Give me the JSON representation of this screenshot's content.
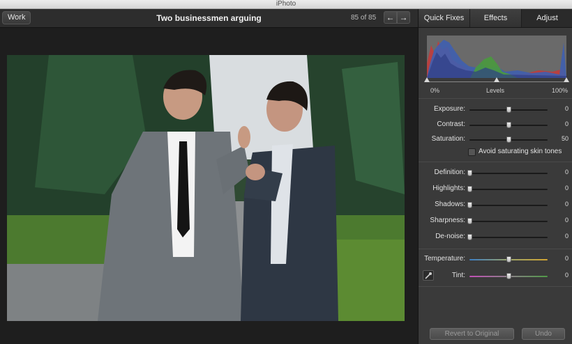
{
  "window": {
    "title": "iPhoto"
  },
  "toolbar": {
    "back_label": "Work",
    "photo_title": "Two businessmen arguing",
    "counter": "85 of 85",
    "prev_icon": "←",
    "next_icon": "→"
  },
  "panel": {
    "tabs": [
      {
        "label": "Quick Fixes",
        "active": false
      },
      {
        "label": "Effects",
        "active": false
      },
      {
        "label": "Adjust",
        "active": true
      }
    ],
    "levels": {
      "label": "Levels",
      "min_label": "0%",
      "max_label": "100%"
    },
    "group1": [
      {
        "label": "Exposure:",
        "value": "0",
        "level": 0.5
      },
      {
        "label": "Contrast:",
        "value": "0",
        "level": 0.5
      },
      {
        "label": "Saturation:",
        "value": "50",
        "level": 0.5
      }
    ],
    "skin_tones": {
      "label": "Avoid saturating skin tones",
      "checked": false
    },
    "group2": [
      {
        "label": "Definition:",
        "value": "0",
        "level": 0
      },
      {
        "label": "Highlights:",
        "value": "0",
        "level": 0
      },
      {
        "label": "Shadows:",
        "value": "0",
        "level": 0
      },
      {
        "label": "Sharpness:",
        "value": "0",
        "level": 0
      },
      {
        "label": "De-noise:",
        "value": "0",
        "level": 0
      }
    ],
    "group3": [
      {
        "label": "Temperature:",
        "value": "0",
        "level": 0.5
      },
      {
        "label": "Tint:",
        "value": "0",
        "level": 0.5
      }
    ],
    "eyedropper_icon": "eyedropper-icon",
    "revert_label": "Revert to Original",
    "undo_label": "Undo"
  }
}
